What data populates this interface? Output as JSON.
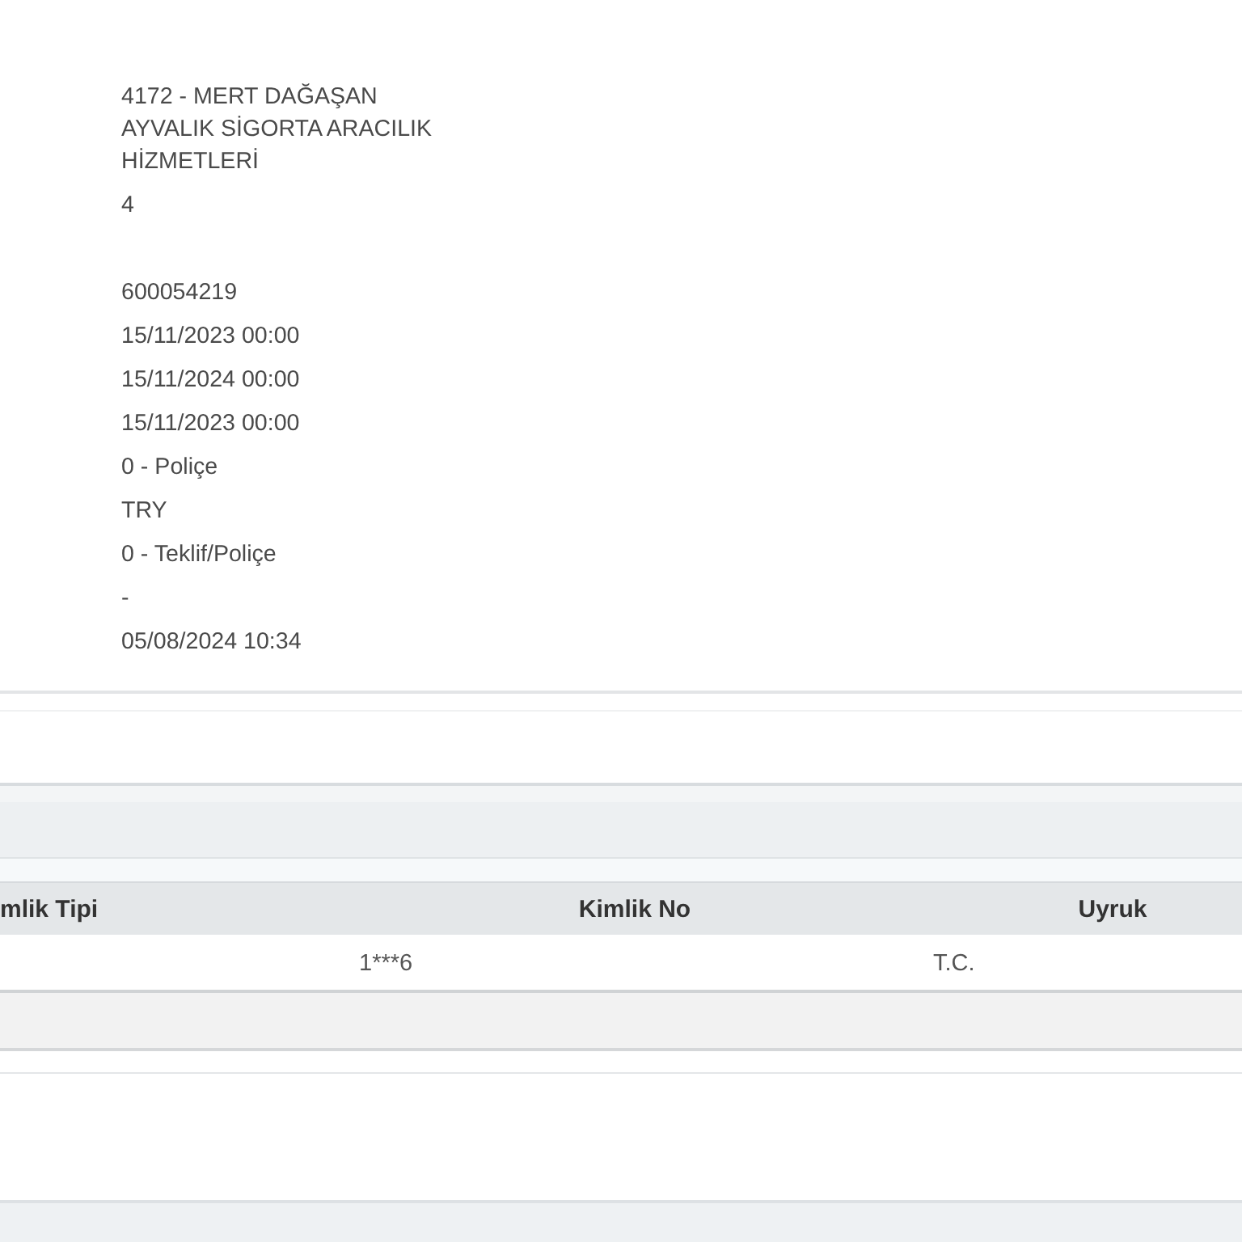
{
  "details": [
    {
      "values": [
        "4172 - MERT DAĞAŞAN AYVALIK SİGORTA ARACILIK HİZMETLERİ",
        "4"
      ]
    },
    {
      "values": [
        "600054219",
        "15/11/2023 00:00",
        "15/11/2024 00:00",
        "15/11/2023 00:00",
        "0 - Poliçe",
        "TRY",
        "0 - Teklif/Poliçe",
        "-",
        "05/08/2024 10:34"
      ]
    }
  ],
  "table": {
    "columns": [
      "mlik Tipi",
      "Kimlik No",
      "Uyruk"
    ],
    "rows": [
      {
        "kimlik_no": "1***6",
        "uyruk": "T.C."
      }
    ]
  }
}
